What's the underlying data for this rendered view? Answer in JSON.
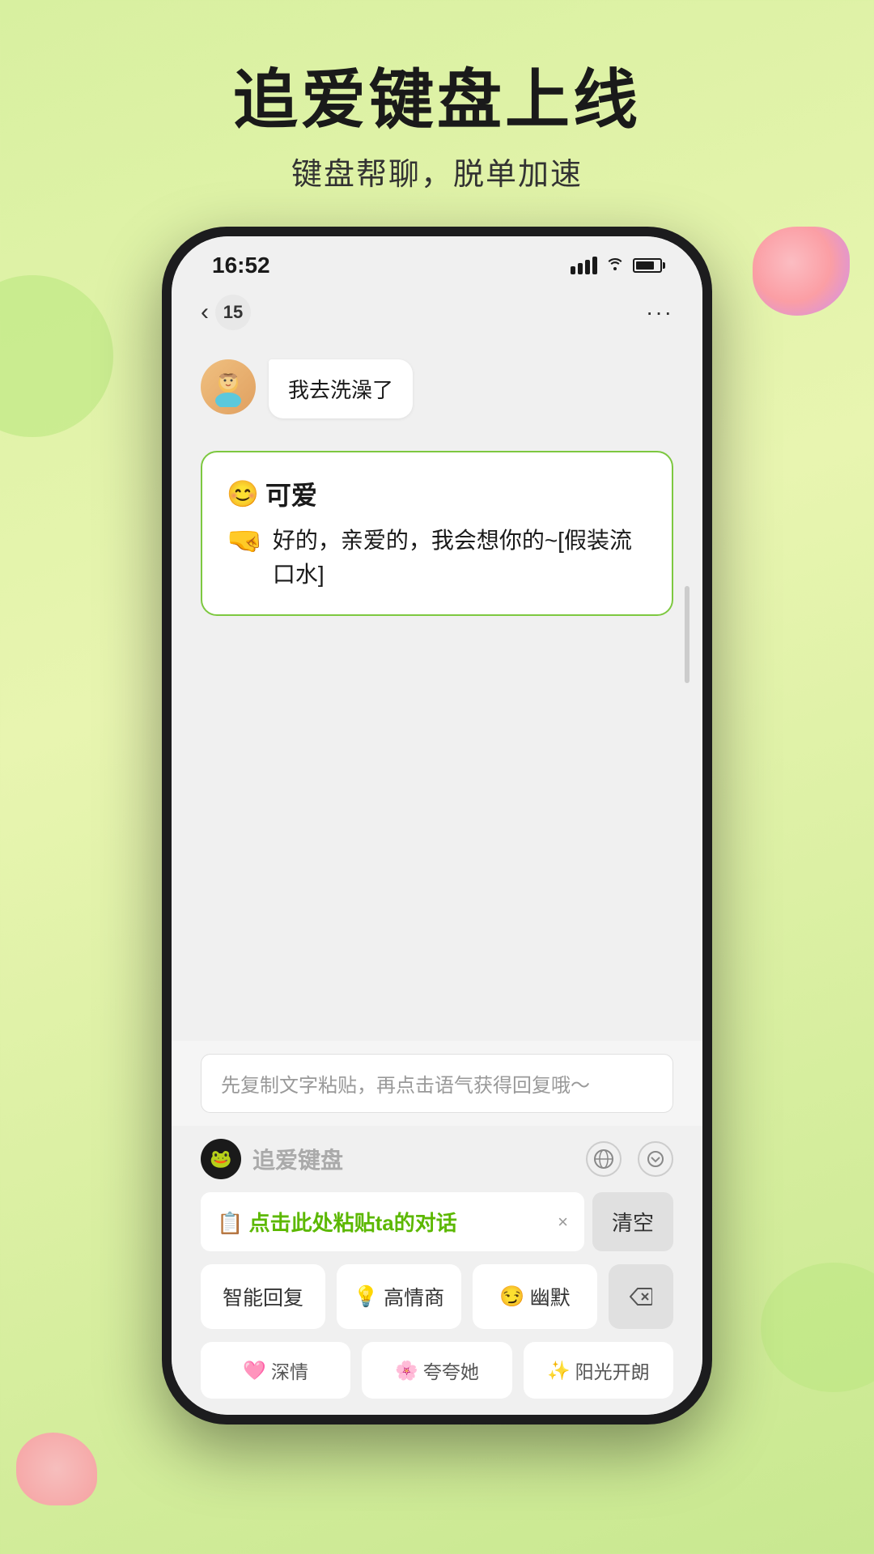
{
  "page": {
    "title": "追爱键盘上线",
    "subtitle": "键盘帮聊，脱单加速",
    "background_color": "#d8f0a0"
  },
  "status_bar": {
    "time": "16:52",
    "signal": "signal",
    "wifi": "wifi",
    "battery": "battery"
  },
  "chat_header": {
    "back_label": "‹",
    "notification_count": "15",
    "more_label": "···"
  },
  "chat": {
    "received_message": "我去洗澡了",
    "ai_suggestion_title": "😊可爱",
    "ai_suggestion_text": "好的，亲爱的，我会想你的~[假装流口水]",
    "hand_emoji": "🤜"
  },
  "input_bar": {
    "placeholder": "先复制文字粘贴，再点击语气获得回复哦～"
  },
  "keyboard": {
    "logo_emoji": "🐸",
    "name": "追爱键盘",
    "globe_icon": "⊕",
    "chevron_icon": "⊙",
    "paste_label": "📋 点击此处粘贴ta的对话",
    "paste_close": "×",
    "clear_btn": "清空",
    "quick_btns": [
      {
        "label": "智能回复",
        "emoji": ""
      },
      {
        "label": "高情商",
        "emoji": "💡"
      },
      {
        "label": "幽默",
        "emoji": "😏"
      },
      {
        "label": "⌫",
        "emoji": ""
      }
    ],
    "mood_btns": [
      {
        "label": "深情",
        "emoji": "🩷"
      },
      {
        "label": "夸夸她",
        "emoji": "🌸"
      },
      {
        "label": "阳光开朗",
        "emoji": "✨"
      }
    ]
  }
}
